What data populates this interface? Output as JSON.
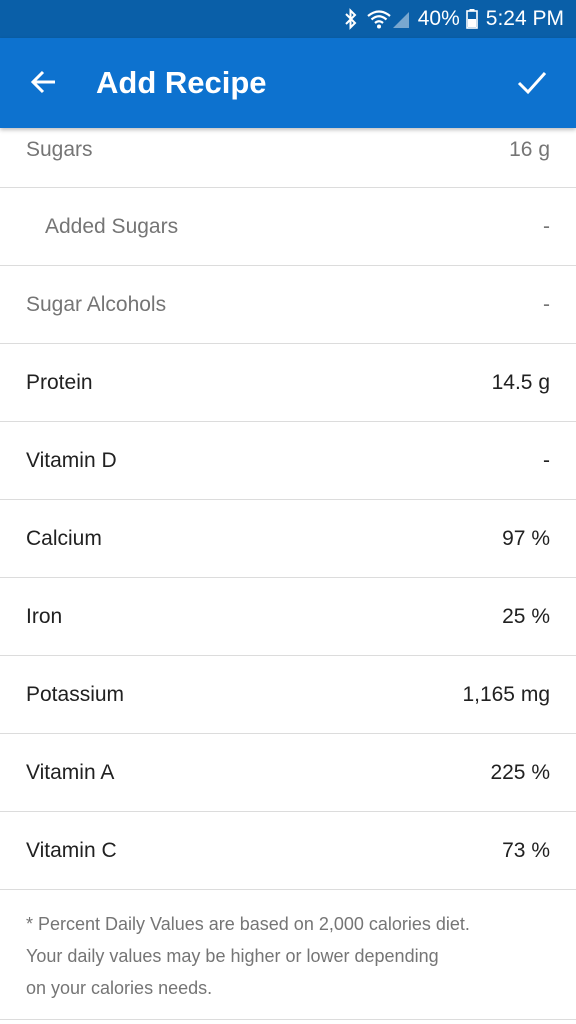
{
  "status_bar": {
    "battery": "40%",
    "time": "5:24 PM",
    "icons": [
      "bluetooth-icon",
      "wifi-icon",
      "signal-icon",
      "battery-icon"
    ]
  },
  "app_bar": {
    "title": "Add Recipe",
    "back_icon": "arrow-left-icon",
    "confirm_icon": "check-icon",
    "background": "#0d72cf"
  },
  "nutrients": [
    {
      "label": "Sugars",
      "value": "16 g"
    },
    {
      "label": "Added Sugars",
      "value": "-"
    },
    {
      "label": "Sugar Alcohols",
      "value": "-"
    },
    {
      "label": "Protein",
      "value": "14.5 g"
    },
    {
      "label": "Vitamin D",
      "value": "-"
    },
    {
      "label": "Calcium",
      "value": "97 %"
    },
    {
      "label": "Iron",
      "value": "25 %"
    },
    {
      "label": "Potassium",
      "value": "1,165 mg"
    },
    {
      "label": "Vitamin A",
      "value": "225 %"
    },
    {
      "label": "Vitamin C",
      "value": "73 %"
    }
  ],
  "footnote": {
    "line1": "* Percent Daily Values are based on 2,000 calories diet.",
    "line2": "Your daily values may be higher or lower depending",
    "line3": "on your calories needs."
  }
}
